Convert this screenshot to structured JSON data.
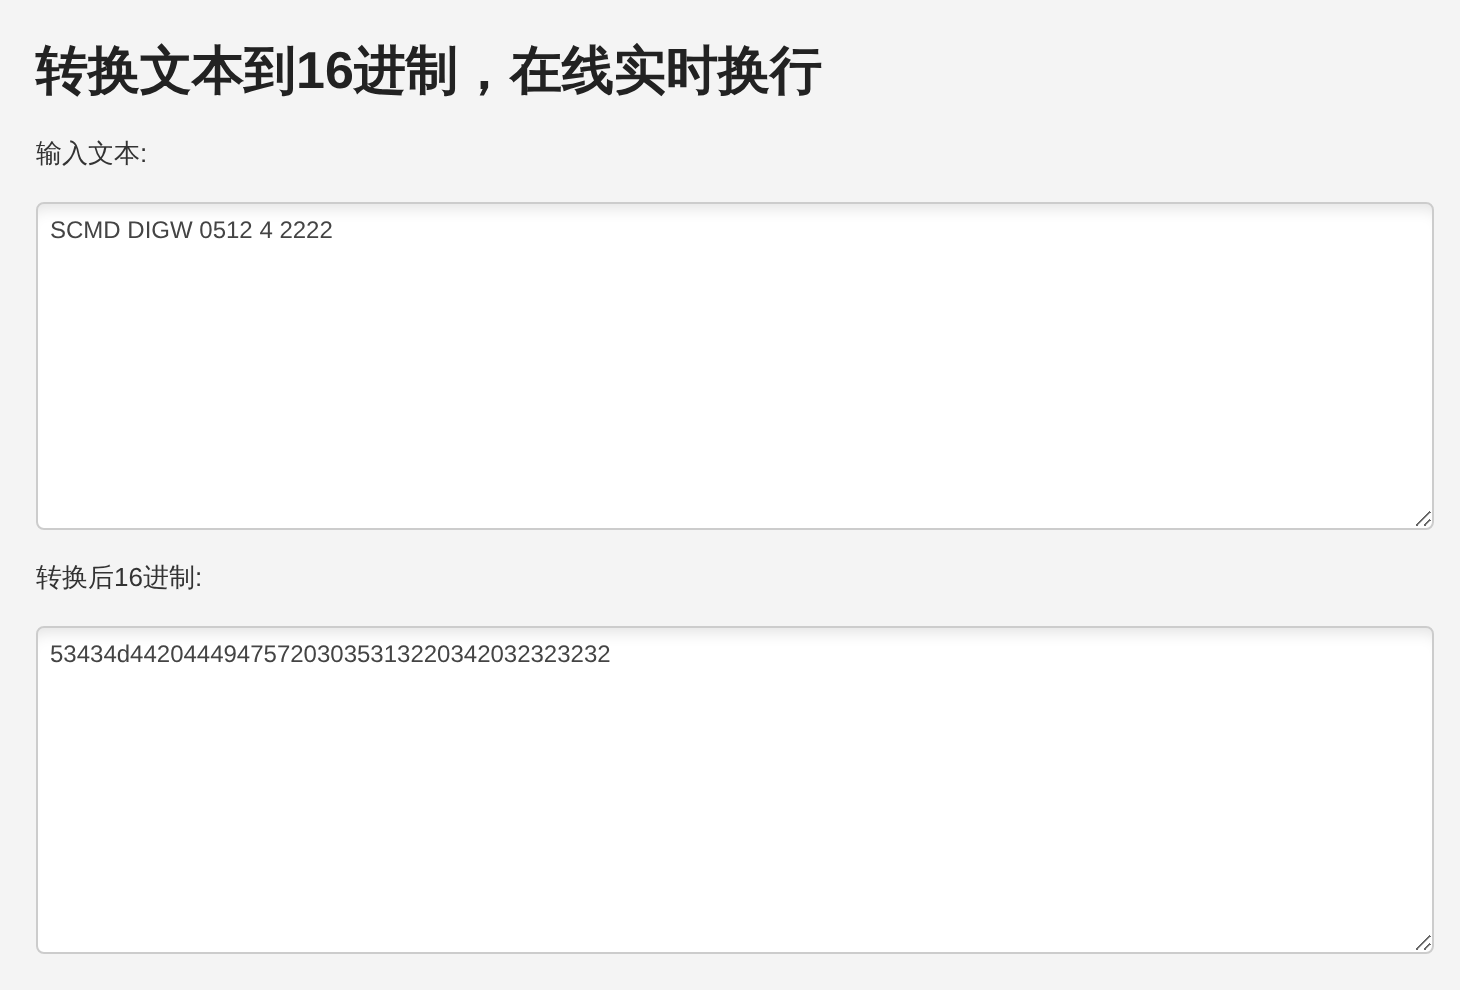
{
  "title": "转换文本到16进制，在线实时换行",
  "fields": [
    {
      "label": "输入文本:",
      "value": "SCMD DIGW 0512 4 2222"
    },
    {
      "label": "转换后16进制:",
      "value": "53434d442044494757203035313220342032323232"
    }
  ]
}
